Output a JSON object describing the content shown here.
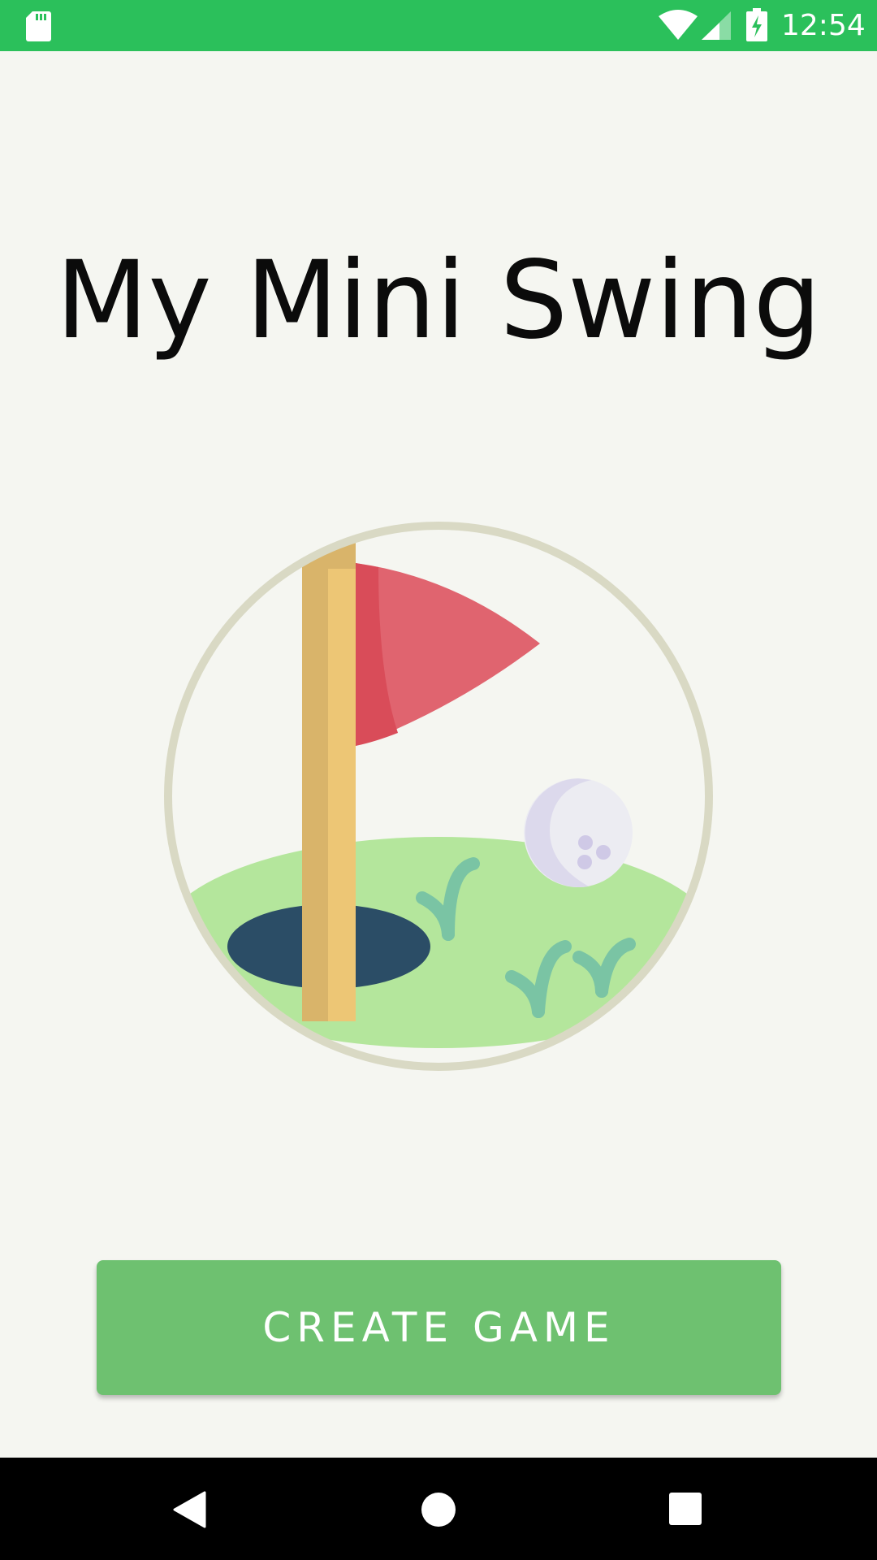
{
  "status_bar": {
    "time": "12:54",
    "icons": [
      "sd-card-icon",
      "wifi-icon",
      "cell-signal-icon",
      "battery-charging-icon"
    ],
    "background_color": "#2bc05b"
  },
  "main": {
    "title": "My Mini Swing",
    "hero_image": "golf-flag-hole-ball-illustration",
    "create_button_label": "CREATE GAME",
    "button_color": "#6ec170"
  },
  "nav_bar": {
    "icons": [
      "back-icon",
      "home-icon",
      "recent-apps-icon"
    ]
  }
}
